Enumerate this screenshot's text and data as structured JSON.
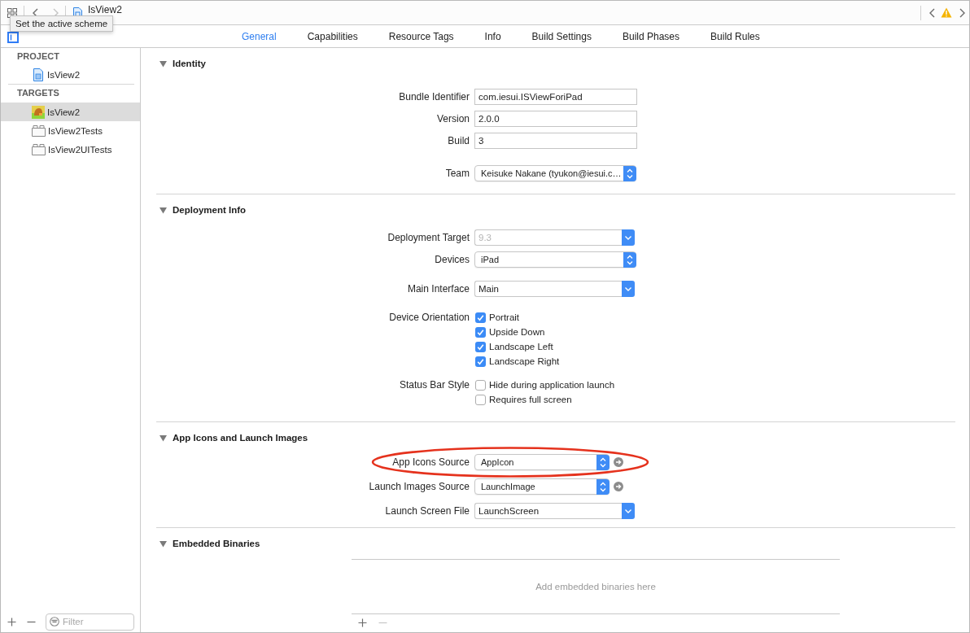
{
  "toolbar": {
    "nav": [
      {
        "kind": "back",
        "disabled": false
      },
      {
        "kind": "forward",
        "disabled": true
      }
    ],
    "breadcrumb": "IsView2",
    "issue_nav": [
      {
        "kind": "back",
        "disabled": false
      },
      {
        "kind": "forward",
        "disabled": false
      }
    ],
    "tooltip": "Set the active scheme"
  },
  "tabs": [
    {
      "label": "General",
      "selected": true
    },
    {
      "label": "Capabilities",
      "selected": false
    },
    {
      "label": "Resource Tags",
      "selected": false
    },
    {
      "label": "Info",
      "selected": false
    },
    {
      "label": "Build Settings",
      "selected": false
    },
    {
      "label": "Build Phases",
      "selected": false
    },
    {
      "label": "Build Rules",
      "selected": false
    }
  ],
  "sidebar": {
    "sections": [
      {
        "title": "PROJECT",
        "items": [
          {
            "label": "IsView2",
            "kind": "project",
            "selected": false
          }
        ]
      },
      {
        "title": "TARGETS",
        "items": [
          {
            "label": "IsView2",
            "kind": "app",
            "selected": true
          },
          {
            "label": "IsView2Tests",
            "kind": "bundle",
            "selected": false
          },
          {
            "label": "IsView2UITests",
            "kind": "bundle",
            "selected": false
          }
        ]
      }
    ],
    "buttons": [
      {
        "kind": "add",
        "disabled": false
      },
      {
        "kind": "remove",
        "disabled": false
      }
    ],
    "filter": {
      "placeholder": "Filter"
    }
  },
  "sections": [
    {
      "title": "Identity",
      "expanded": true,
      "groups": [
        {
          "rows": [
            {
              "label": "Bundle Identifier",
              "kind": "text",
              "value": "com.iesui.ISViewForiPad"
            },
            {
              "label": "Version",
              "kind": "text",
              "value": "2.0.0"
            },
            {
              "label": "Build",
              "kind": "text",
              "value": "3"
            }
          ]
        },
        {
          "rows": [
            {
              "label": "Team",
              "kind": "popup",
              "value": "Keisuke Nakane (tyukon@iesui.c…"
            }
          ]
        }
      ]
    },
    {
      "title": "Deployment Info",
      "expanded": true,
      "groups": [
        {
          "rows": [
            {
              "label": "Deployment Target",
              "kind": "combo",
              "placeholder": "9.3"
            },
            {
              "label": "Devices",
              "kind": "popup",
              "value": "iPad"
            }
          ]
        },
        {
          "rows": [
            {
              "label": "Main Interface",
              "kind": "combo",
              "value": "Main"
            }
          ]
        },
        {
          "rows": [
            {
              "label": "Device Orientation",
              "kind": "checks",
              "options": [
                {
                  "label": "Portrait",
                  "checked": true
                },
                {
                  "label": "Upside Down",
                  "checked": true
                },
                {
                  "label": "Landscape Left",
                  "checked": true
                },
                {
                  "label": "Landscape Right",
                  "checked": true
                }
              ]
            }
          ]
        },
        {
          "rows": [
            {
              "label": "Status Bar Style",
              "kind": "checks",
              "options": [
                {
                  "label": "Hide during application launch",
                  "checked": false
                },
                {
                  "label": "Requires full screen",
                  "checked": false
                }
              ]
            }
          ]
        }
      ]
    },
    {
      "title": "App Icons and Launch Images",
      "expanded": true,
      "groups": [
        {
          "rows": [
            {
              "label": "App Icons Source",
              "kind": "asset",
              "value": "AppIcon",
              "highlighted": true
            },
            {
              "label": "Launch Images Source",
              "kind": "asset",
              "value": "LaunchImage",
              "highlighted": false
            },
            {
              "label": "Launch Screen File",
              "kind": "combo",
              "value": "LaunchScreen"
            }
          ]
        }
      ]
    },
    {
      "title": "Embedded Binaries",
      "expanded": true,
      "empty_text": "Add embedded binaries here",
      "buttons": [
        {
          "kind": "add",
          "disabled": false
        },
        {
          "kind": "remove",
          "disabled": true
        }
      ]
    }
  ]
}
